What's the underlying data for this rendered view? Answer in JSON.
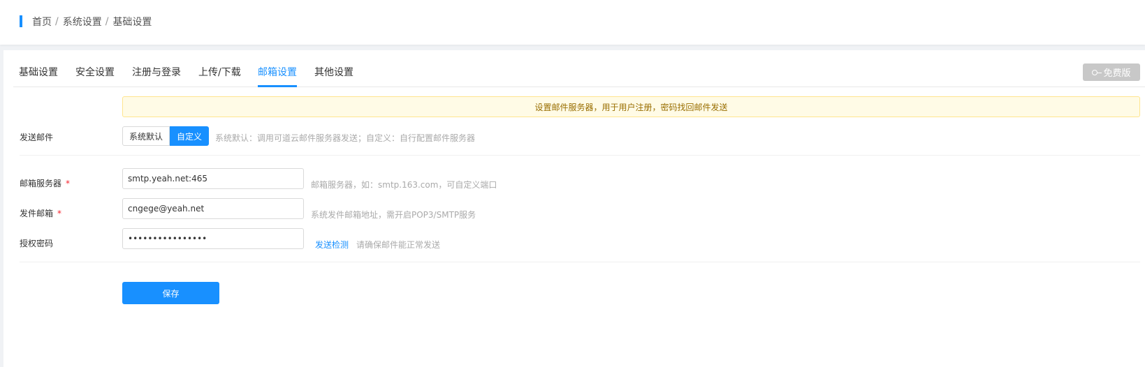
{
  "breadcrumb": {
    "items": [
      "首页",
      "系统设置",
      "基础设置"
    ],
    "separator": "/"
  },
  "tabs": [
    {
      "label": "基础设置",
      "active": false
    },
    {
      "label": "安全设置",
      "active": false
    },
    {
      "label": "注册与登录",
      "active": false
    },
    {
      "label": "上传/下载",
      "active": false
    },
    {
      "label": "邮箱设置",
      "active": true
    },
    {
      "label": "其他设置",
      "active": false
    }
  ],
  "free_badge": {
    "label": "免费版",
    "icon": "key-icon"
  },
  "notice": "设置邮件服务器，用于用户注册，密码找回邮件发送",
  "send_mail": {
    "label": "发送邮件",
    "options": [
      "系统默认",
      "自定义"
    ],
    "selected": "自定义",
    "hint": "系统默认：调用可道云邮件服务器发送；自定义：自行配置邮件服务器"
  },
  "mail_server": {
    "label": "邮箱服务器",
    "required": "*",
    "value": "smtp.yeah.net:465",
    "hint": "邮箱服务器，如：smtp.163.com，可自定义端口"
  },
  "sender_email": {
    "label": "发件邮箱",
    "required": "*",
    "value": "cngege@yeah.net",
    "hint": "系统发件邮箱地址，需开启POP3/SMTP服务"
  },
  "auth_password": {
    "label": "授权密码",
    "value": "0123456789abcdef",
    "test_link": "发送检测",
    "hint": "请确保邮件能正常发送"
  },
  "save_label": "保存",
  "colors": {
    "accent": "#1890ff",
    "notice_bg": "#fffbe6",
    "notice_text": "#996e00",
    "required": "#f5222d",
    "disabled_badge": "#c8c8c8"
  }
}
